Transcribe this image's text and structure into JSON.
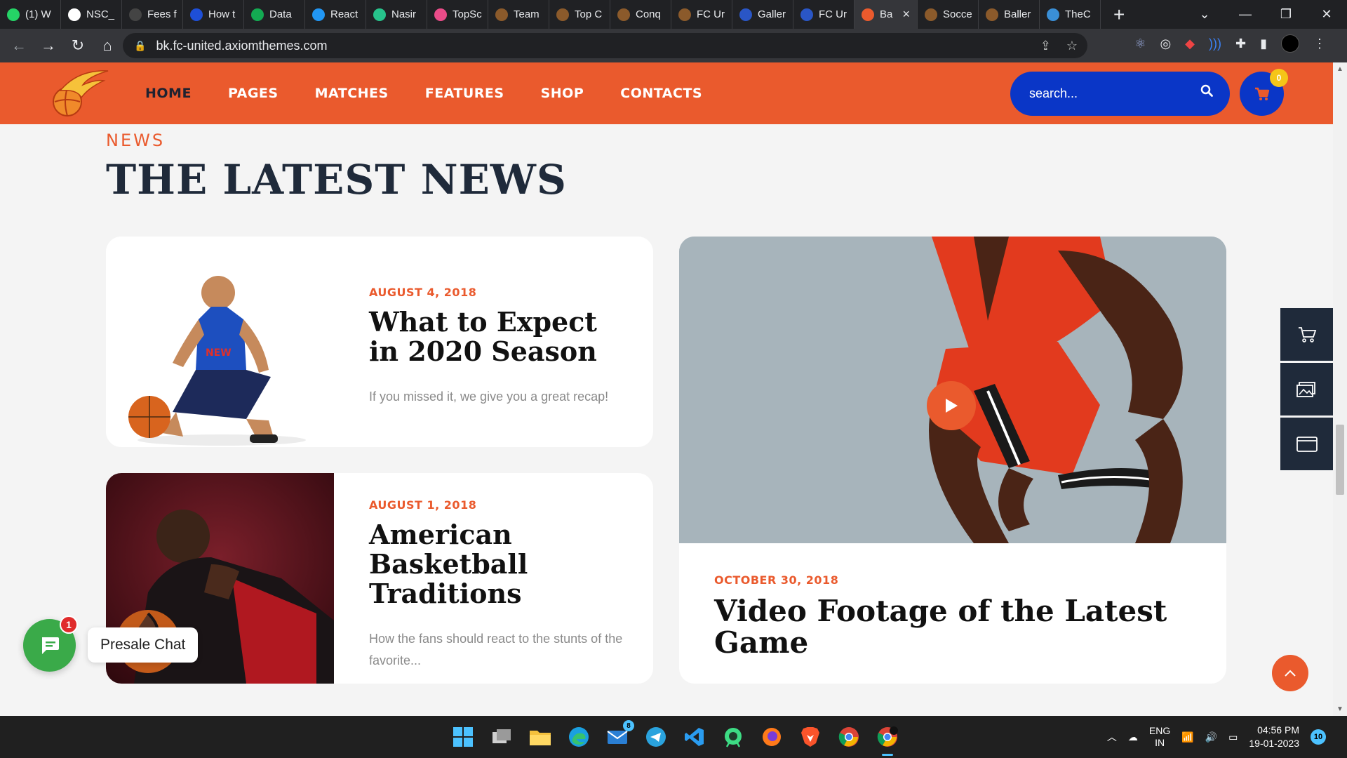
{
  "browser": {
    "tabs": [
      {
        "label": "(1) W",
        "icon": "whatsapp-icon",
        "color": "#25d366"
      },
      {
        "label": "NSC_",
        "icon": "github-icon",
        "color": "#ffffff"
      },
      {
        "label": "Fees f",
        "icon": "page-icon",
        "color": "#444444"
      },
      {
        "label": "How t",
        "icon": "bookmark-icon",
        "color": "#1e4fd8"
      },
      {
        "label": "Data",
        "icon": "mongodb-icon",
        "color": "#13aa52"
      },
      {
        "label": "React",
        "icon": "mui-icon",
        "color": "#2196f3"
      },
      {
        "label": "Nasir",
        "icon": "chat-icon",
        "color": "#27c28b"
      },
      {
        "label": "TopSc",
        "icon": "dribbble-icon",
        "color": "#ea4c89"
      },
      {
        "label": "Team",
        "icon": "theme-icon",
        "color": "#8b5a2b"
      },
      {
        "label": "Top C",
        "icon": "theme-icon",
        "color": "#8b5a2b"
      },
      {
        "label": "Conq",
        "icon": "theme-icon",
        "color": "#8b5a2b"
      },
      {
        "label": "FC Ur",
        "icon": "theme-icon",
        "color": "#8b5a2b"
      },
      {
        "label": "Galler",
        "icon": "soccer-icon",
        "color": "#2a56c6"
      },
      {
        "label": "FC Ur",
        "icon": "soccer-icon",
        "color": "#2a56c6"
      },
      {
        "label": "Ba",
        "icon": "basketball-icon",
        "color": "#ea5a2d",
        "active": true
      },
      {
        "label": "Socce",
        "icon": "theme-icon",
        "color": "#8b5a2b"
      },
      {
        "label": "Baller",
        "icon": "theme-icon",
        "color": "#8b5a2b"
      },
      {
        "label": "TheC",
        "icon": "globe-icon",
        "color": "#3a8fd6"
      }
    ],
    "new_tab": "+",
    "url": "bk.fc-united.axiomthemes.com"
  },
  "site": {
    "nav": [
      "HOME",
      "PAGES",
      "MATCHES",
      "FEATURES",
      "SHOP",
      "CONTACTS"
    ],
    "search_placeholder": "search...",
    "cart_count": "0",
    "accent": "#ea5a2d",
    "blue": "#0a36c7"
  },
  "section": {
    "eyebrow": "NEWS",
    "title": "THE LATEST NEWS"
  },
  "posts": [
    {
      "date": "AUGUST 4, 2018",
      "title": "What to Expect in 2020 Season",
      "excerpt": "If you missed it, we give you a great recap!"
    },
    {
      "date": "AUGUST 1, 2018",
      "title": "American Basketball Traditions",
      "excerpt": "How the fans should react to the stunts of the favorite..."
    },
    {
      "date": "OCTOBER 30, 2018",
      "title": "Video Footage of the Latest Game"
    }
  ],
  "chat": {
    "label": "Presale Chat",
    "unread": "1"
  },
  "taskbar": {
    "mail_badge": "8",
    "lang_line1": "ENG",
    "lang_line2": "IN",
    "time": "04:56 PM",
    "date": "19-01-2023",
    "notifications": "10"
  }
}
